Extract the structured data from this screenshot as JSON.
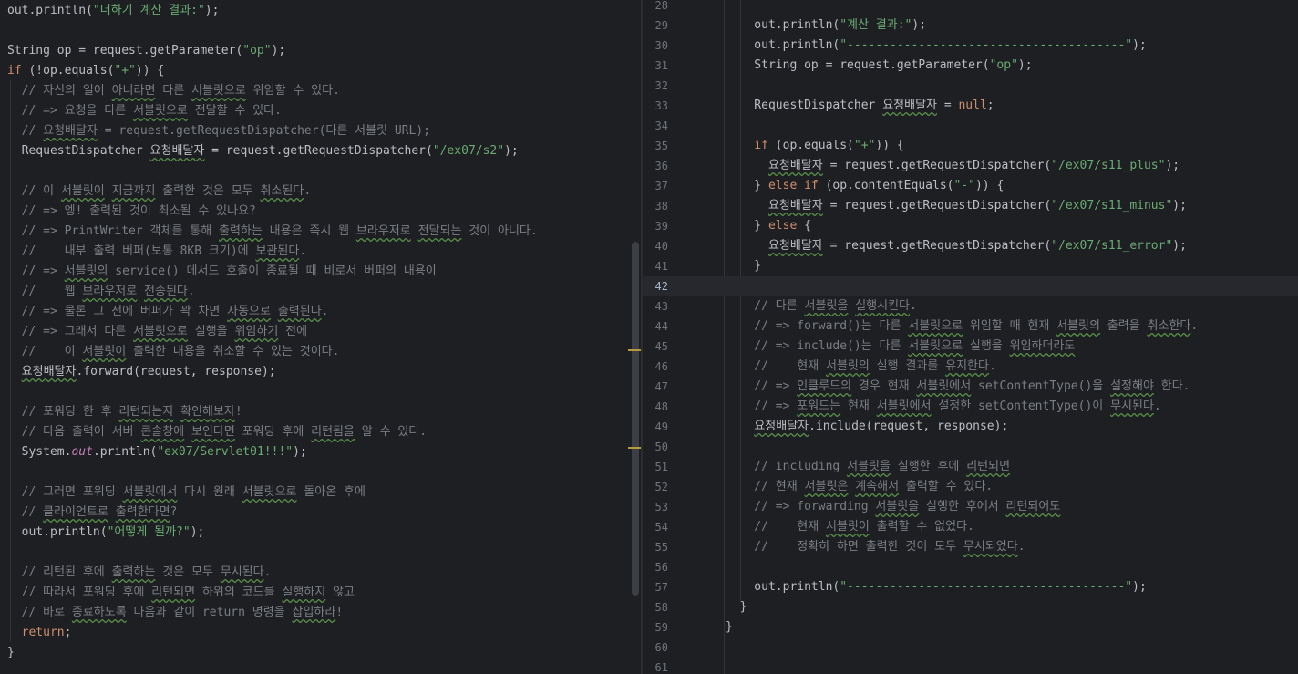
{
  "left_editor": {
    "lines": [
      [
        {
          "t": "out.println("
        },
        {
          "t": "\"더하기 계산 결과:\"",
          "c": "str"
        },
        {
          "t": ");"
        }
      ],
      [],
      [
        {
          "t": "String op = request.getParameter("
        },
        {
          "t": "\"op\"",
          "c": "str"
        },
        {
          "t": ");"
        }
      ],
      [
        {
          "t": "if",
          "c": "kw"
        },
        {
          "t": " (!op.equals("
        },
        {
          "t": "\"+\"",
          "c": "str"
        },
        {
          "t": ")) {"
        }
      ],
      [
        {
          "t": "  // 자신의 일이 ",
          "c": "cmt"
        },
        {
          "t": "아니라면",
          "c": "cmt sq"
        },
        {
          "t": " 다른 ",
          "c": "cmt"
        },
        {
          "t": "서블릿으로",
          "c": "cmt sq"
        },
        {
          "t": " 위임할 수 있다.",
          "c": "cmt"
        }
      ],
      [
        {
          "t": "  // => 요청을 다른 ",
          "c": "cmt"
        },
        {
          "t": "서블릿으로",
          "c": "cmt sq"
        },
        {
          "t": " 전달할 수 있다.",
          "c": "cmt"
        }
      ],
      [
        {
          "t": "  // ",
          "c": "cmt"
        },
        {
          "t": "요청배달자",
          "c": "cmt sq"
        },
        {
          "t": " = request.getRequestDispatcher(다른 서블릿 URL);",
          "c": "cmt"
        }
      ],
      [
        {
          "t": "  RequestDispatcher "
        },
        {
          "t": "요청배달자",
          "c": "sq"
        },
        {
          "t": " = request.getRequestDispatcher("
        },
        {
          "t": "\"/ex07/s2\"",
          "c": "str"
        },
        {
          "t": ");"
        }
      ],
      [],
      [
        {
          "t": "  // 이 ",
          "c": "cmt"
        },
        {
          "t": "서블릿이",
          "c": "cmt sq"
        },
        {
          "t": " ",
          "c": "cmt"
        },
        {
          "t": "지금까지",
          "c": "cmt sq"
        },
        {
          "t": " 출력한 것은 모두 ",
          "c": "cmt"
        },
        {
          "t": "취소된다",
          "c": "cmt sq"
        },
        {
          "t": ".",
          "c": "cmt"
        }
      ],
      [
        {
          "t": "  // => 엥! 출력된 것이 최소될 수 있나요?",
          "c": "cmt"
        }
      ],
      [
        {
          "t": "  // => PrintWriter 객체를 통해 ",
          "c": "cmt"
        },
        {
          "t": "출력하는",
          "c": "cmt sq"
        },
        {
          "t": " 내용은 즉시 웹 ",
          "c": "cmt"
        },
        {
          "t": "브라우저로",
          "c": "cmt sq"
        },
        {
          "t": " ",
          "c": "cmt"
        },
        {
          "t": "전달되는",
          "c": "cmt sq"
        },
        {
          "t": " 것이 아니다.",
          "c": "cmt"
        }
      ],
      [
        {
          "t": "  //    내부 출력 버퍼(보통 8KB 크기)에 ",
          "c": "cmt"
        },
        {
          "t": "보관된다",
          "c": "cmt sq"
        },
        {
          "t": ".",
          "c": "cmt"
        }
      ],
      [
        {
          "t": "  // => ",
          "c": "cmt"
        },
        {
          "t": "서블릿의",
          "c": "cmt sq"
        },
        {
          "t": " service() 메서드 호출이 종료될 때 비로서 버퍼의 내용이",
          "c": "cmt"
        }
      ],
      [
        {
          "t": "  //    웹 ",
          "c": "cmt"
        },
        {
          "t": "브라우저로",
          "c": "cmt sq"
        },
        {
          "t": " ",
          "c": "cmt"
        },
        {
          "t": "전송된다",
          "c": "cmt sq"
        },
        {
          "t": ".",
          "c": "cmt"
        }
      ],
      [
        {
          "t": "  // => 물론 그 전에 버퍼가 꽉 차면 ",
          "c": "cmt"
        },
        {
          "t": "자동으로",
          "c": "cmt sq"
        },
        {
          "t": " ",
          "c": "cmt"
        },
        {
          "t": "출력된다",
          "c": "cmt sq"
        },
        {
          "t": ".",
          "c": "cmt"
        }
      ],
      [
        {
          "t": "  // => 그래서 다른 ",
          "c": "cmt"
        },
        {
          "t": "서블릿으로",
          "c": "cmt sq"
        },
        {
          "t": " 실행을 ",
          "c": "cmt"
        },
        {
          "t": "위임하기",
          "c": "cmt sq"
        },
        {
          "t": " 전에",
          "c": "cmt"
        }
      ],
      [
        {
          "t": "  //    이 ",
          "c": "cmt"
        },
        {
          "t": "서블릿이",
          "c": "cmt sq"
        },
        {
          "t": " 출력한 내용을 취소할 수 있는 것이다.",
          "c": "cmt"
        }
      ],
      [
        {
          "t": "  "
        },
        {
          "t": "요청배달자",
          "c": "sq"
        },
        {
          "t": ".forward(request, response);"
        }
      ],
      [],
      [
        {
          "t": "  // 포워딩 한 후 ",
          "c": "cmt"
        },
        {
          "t": "리턴되는지",
          "c": "cmt sq"
        },
        {
          "t": " ",
          "c": "cmt"
        },
        {
          "t": "확인해보자",
          "c": "cmt sq"
        },
        {
          "t": "!",
          "c": "cmt"
        }
      ],
      [
        {
          "t": "  // 다음 출력이 서버 ",
          "c": "cmt"
        },
        {
          "t": "콘솔창에",
          "c": "cmt sq"
        },
        {
          "t": " ",
          "c": "cmt"
        },
        {
          "t": "보인다면",
          "c": "cmt sq"
        },
        {
          "t": " 포워딩 후에 ",
          "c": "cmt"
        },
        {
          "t": "리턴됨을",
          "c": "cmt sq"
        },
        {
          "t": " 알 수 있다.",
          "c": "cmt"
        }
      ],
      [
        {
          "t": "  System."
        },
        {
          "t": "out",
          "c": "field"
        },
        {
          "t": ".println("
        },
        {
          "t": "\"ex07/Servlet01!!!\"",
          "c": "str"
        },
        {
          "t": ");"
        }
      ],
      [],
      [
        {
          "t": "  // 그러면 포워딩 ",
          "c": "cmt"
        },
        {
          "t": "서블릿에서",
          "c": "cmt sq"
        },
        {
          "t": " 다시 원래 ",
          "c": "cmt"
        },
        {
          "t": "서블릿으로",
          "c": "cmt sq"
        },
        {
          "t": " 돌아온 후에",
          "c": "cmt"
        }
      ],
      [
        {
          "t": "  // ",
          "c": "cmt"
        },
        {
          "t": "클라이언트로",
          "c": "cmt sq"
        },
        {
          "t": " ",
          "c": "cmt"
        },
        {
          "t": "출력한다면",
          "c": "cmt sq"
        },
        {
          "t": "?",
          "c": "cmt"
        }
      ],
      [
        {
          "t": "  out.println("
        },
        {
          "t": "\"어떻게 될까?\"",
          "c": "str"
        },
        {
          "t": ");"
        }
      ],
      [],
      [
        {
          "t": "  // 리턴된 후에 ",
          "c": "cmt"
        },
        {
          "t": "출력하는",
          "c": "cmt sq"
        },
        {
          "t": " 것은 모두 ",
          "c": "cmt"
        },
        {
          "t": "무시된다",
          "c": "cmt sq"
        },
        {
          "t": ".",
          "c": "cmt"
        }
      ],
      [
        {
          "t": "  // 따라서 포워딩 후에 ",
          "c": "cmt"
        },
        {
          "t": "리턴되면",
          "c": "cmt sq"
        },
        {
          "t": " 하위의 코드를 ",
          "c": "cmt"
        },
        {
          "t": "실행하지",
          "c": "cmt sq"
        },
        {
          "t": " 않고",
          "c": "cmt"
        }
      ],
      [
        {
          "t": "  // 바로 ",
          "c": "cmt"
        },
        {
          "t": "종료하도록",
          "c": "cmt sq"
        },
        {
          "t": " 다음과 같이 return 명령을 ",
          "c": "cmt"
        },
        {
          "t": "삽입하라",
          "c": "cmt sq"
        },
        {
          "t": "!",
          "c": "cmt"
        }
      ],
      [
        {
          "t": "  "
        },
        {
          "t": "return",
          "c": "kw"
        },
        {
          "t": ";"
        }
      ],
      [
        {
          "t": "}"
        }
      ]
    ]
  },
  "right_editor": {
    "first_line_number": 28,
    "active_line_number": 42,
    "lines": [
      [],
      [
        {
          "t": "    out.println("
        },
        {
          "t": "\"계산 결과:\"",
          "c": "str"
        },
        {
          "t": ");"
        }
      ],
      [
        {
          "t": "    out.println("
        },
        {
          "t": "\"---------------------------------------\"",
          "c": "str"
        },
        {
          "t": ");"
        }
      ],
      [
        {
          "t": "    String op = request.getParameter("
        },
        {
          "t": "\"op\"",
          "c": "str"
        },
        {
          "t": ");"
        }
      ],
      [],
      [
        {
          "t": "    RequestDispatcher "
        },
        {
          "t": "요청배달자",
          "c": "sq"
        },
        {
          "t": " = "
        },
        {
          "t": "null",
          "c": "kw"
        },
        {
          "t": ";"
        }
      ],
      [],
      [
        {
          "t": "    "
        },
        {
          "t": "if",
          "c": "kw"
        },
        {
          "t": " (op.equals("
        },
        {
          "t": "\"+\"",
          "c": "str"
        },
        {
          "t": ")) {"
        }
      ],
      [
        {
          "t": "      "
        },
        {
          "t": "요청배달자",
          "c": "sq"
        },
        {
          "t": " = request.getRequestDispatcher("
        },
        {
          "t": "\"/ex07/s11_plus\"",
          "c": "str"
        },
        {
          "t": ");"
        }
      ],
      [
        {
          "t": "    } "
        },
        {
          "t": "else if",
          "c": "kw"
        },
        {
          "t": " (op.contentEquals("
        },
        {
          "t": "\"-\"",
          "c": "str"
        },
        {
          "t": ")) {"
        }
      ],
      [
        {
          "t": "      "
        },
        {
          "t": "요청배달자",
          "c": "sq"
        },
        {
          "t": " = request.getRequestDispatcher("
        },
        {
          "t": "\"/ex07/s11_minus\"",
          "c": "str"
        },
        {
          "t": ");"
        }
      ],
      [
        {
          "t": "    } "
        },
        {
          "t": "else",
          "c": "kw"
        },
        {
          "t": " {"
        }
      ],
      [
        {
          "t": "      "
        },
        {
          "t": "요청배달자",
          "c": "sq"
        },
        {
          "t": " = request.getRequestDispatcher("
        },
        {
          "t": "\"/ex07/s11_error\"",
          "c": "str"
        },
        {
          "t": ");"
        }
      ],
      [
        {
          "t": "    }"
        }
      ],
      [],
      [
        {
          "t": "    // 다른 ",
          "c": "cmt"
        },
        {
          "t": "서블릿을",
          "c": "cmt sq"
        },
        {
          "t": " ",
          "c": "cmt"
        },
        {
          "t": "실행시킨다",
          "c": "cmt sq"
        },
        {
          "t": ".",
          "c": "cmt"
        }
      ],
      [
        {
          "t": "    // => forward()는 다른 ",
          "c": "cmt"
        },
        {
          "t": "서블릿으로",
          "c": "cmt sq"
        },
        {
          "t": " 위임할 때 현재 ",
          "c": "cmt"
        },
        {
          "t": "서블릿의",
          "c": "cmt sq"
        },
        {
          "t": " 출력을 ",
          "c": "cmt"
        },
        {
          "t": "취소한다",
          "c": "cmt sq"
        },
        {
          "t": ".",
          "c": "cmt"
        }
      ],
      [
        {
          "t": "    // => include()는 다른 ",
          "c": "cmt"
        },
        {
          "t": "서블릿으로",
          "c": "cmt sq"
        },
        {
          "t": " 실행을 ",
          "c": "cmt"
        },
        {
          "t": "위임하더라도",
          "c": "cmt sq"
        }
      ],
      [
        {
          "t": "    //    현재 ",
          "c": "cmt"
        },
        {
          "t": "서블릿의",
          "c": "cmt sq"
        },
        {
          "t": " 실행 결과를 ",
          "c": "cmt"
        },
        {
          "t": "유지한다",
          "c": "cmt sq"
        },
        {
          "t": ".",
          "c": "cmt"
        }
      ],
      [
        {
          "t": "    // => ",
          "c": "cmt"
        },
        {
          "t": "인클루드의",
          "c": "cmt sq"
        },
        {
          "t": " 경우 현재 ",
          "c": "cmt"
        },
        {
          "t": "서블릿에서",
          "c": "cmt sq"
        },
        {
          "t": " setContentType()을 ",
          "c": "cmt"
        },
        {
          "t": "설정해야",
          "c": "cmt sq"
        },
        {
          "t": " 한다.",
          "c": "cmt"
        }
      ],
      [
        {
          "t": "    // => ",
          "c": "cmt"
        },
        {
          "t": "포워드는",
          "c": "cmt sq"
        },
        {
          "t": " 현재 ",
          "c": "cmt"
        },
        {
          "t": "서블릿에서",
          "c": "cmt sq"
        },
        {
          "t": " 설정한 setContentType()이 ",
          "c": "cmt"
        },
        {
          "t": "무시된다",
          "c": "cmt sq"
        },
        {
          "t": ".",
          "c": "cmt"
        }
      ],
      [
        {
          "t": "    "
        },
        {
          "t": "요청배달자",
          "c": "sq"
        },
        {
          "t": ".include(request, response);"
        }
      ],
      [],
      [
        {
          "t": "    // including ",
          "c": "cmt"
        },
        {
          "t": "서블릿을",
          "c": "cmt sq"
        },
        {
          "t": " 실행한 후에 ",
          "c": "cmt"
        },
        {
          "t": "리턴되면",
          "c": "cmt sq"
        }
      ],
      [
        {
          "t": "    // 현재 ",
          "c": "cmt"
        },
        {
          "t": "서블릿은",
          "c": "cmt sq"
        },
        {
          "t": " ",
          "c": "cmt"
        },
        {
          "t": "계속해서",
          "c": "cmt sq"
        },
        {
          "t": " 출력할 수 있다.",
          "c": "cmt"
        }
      ],
      [
        {
          "t": "    // => forwarding ",
          "c": "cmt"
        },
        {
          "t": "서블릿을",
          "c": "cmt sq"
        },
        {
          "t": " 실행한 후에서 ",
          "c": "cmt"
        },
        {
          "t": "리턴되어도",
          "c": "cmt sq"
        }
      ],
      [
        {
          "t": "    //    현재 ",
          "c": "cmt"
        },
        {
          "t": "서블릿이",
          "c": "cmt sq"
        },
        {
          "t": " 출력할 수 없었다.",
          "c": "cmt"
        }
      ],
      [
        {
          "t": "    //    정확히 하면 출력한 것이 모두 ",
          "c": "cmt"
        },
        {
          "t": "무시되었다",
          "c": "cmt sq"
        },
        {
          "t": ".",
          "c": "cmt"
        }
      ],
      [],
      [
        {
          "t": "    out.println("
        },
        {
          "t": "\"---------------------------------------\"",
          "c": "str"
        },
        {
          "t": ");"
        }
      ],
      [
        {
          "t": "  }"
        }
      ],
      [
        {
          "t": "}"
        }
      ],
      [],
      []
    ]
  },
  "colors": {
    "background": "#1e1f22",
    "keyword": "#cf8e6d",
    "string": "#6aab73",
    "comment": "#7a7e85",
    "text": "#bcbec4",
    "line_number": "#6f737a"
  }
}
